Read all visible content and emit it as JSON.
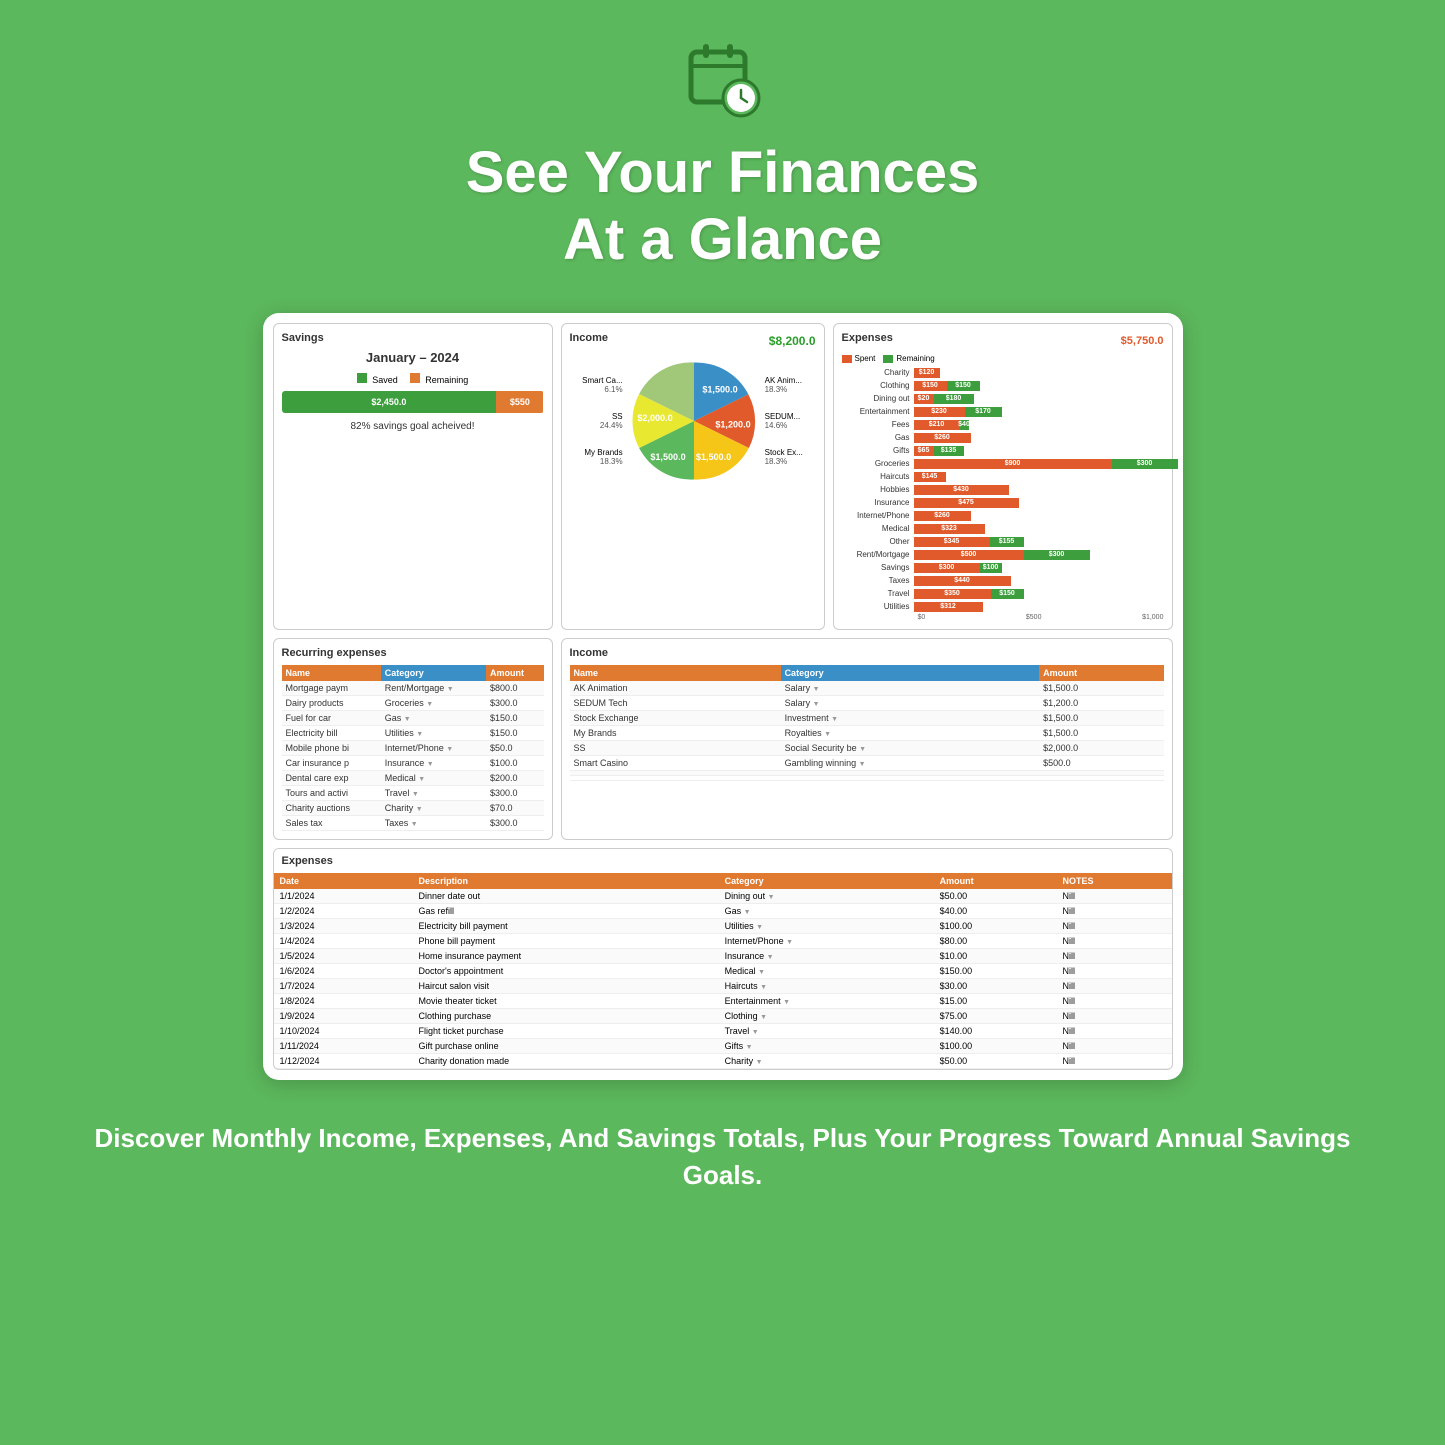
{
  "header": {
    "title_line1": "See Your Finances",
    "title_line2": "At a Glance",
    "icon_label": "calendar-clock-icon"
  },
  "savings": {
    "title": "Savings",
    "month": "January – 2024",
    "legend_saved": "Saved",
    "legend_remaining": "Remaining",
    "saved_amount": "$2,450.0",
    "remaining_amount": "$550",
    "goal_text": "82% savings goal acheived!",
    "saved_pct": 82,
    "remaining_pct": 18
  },
  "income": {
    "title": "Income",
    "total": "$8,200.0",
    "segments": [
      {
        "label": "AK Anim...",
        "pct": 18.3,
        "value": 1500,
        "color": "#3a8fc7"
      },
      {
        "label": "SEDUM...",
        "pct": 14.6,
        "value": 1200,
        "color": "#e05a2b"
      },
      {
        "label": "Stock Ex...",
        "pct": 18.3,
        "value": 1500,
        "color": "#f5c518"
      },
      {
        "label": "My Brands",
        "pct": 18.3,
        "value": 1500,
        "color": "#5cb85c"
      },
      {
        "label": "SS",
        "pct": 24.4,
        "value": 2000,
        "color": "#e8e830"
      },
      {
        "label": "Smart Ca...",
        "pct": 6.1,
        "value": 500,
        "color": "#a0c878"
      }
    ]
  },
  "expenses_chart": {
    "title": "Expenses",
    "total": "$5,750.0",
    "legend_spent": "Spent",
    "legend_remaining": "Remaining",
    "max_val": 1000,
    "axis_labels": [
      "$0",
      "$500",
      "$1,000"
    ],
    "bars": [
      {
        "label": "Charity",
        "spent": 120,
        "remaining": 0
      },
      {
        "label": "Clothing",
        "spent": 150,
        "remaining": 150
      },
      {
        "label": "Dining out",
        "spent": 20,
        "remaining": 180
      },
      {
        "label": "Entertainment",
        "spent": 230,
        "remaining": 170
      },
      {
        "label": "Fees",
        "spent": 210,
        "remaining": 40
      },
      {
        "label": "Gas",
        "spent": 260,
        "remaining": 0
      },
      {
        "label": "Gifts",
        "spent": 65,
        "remaining": 135
      },
      {
        "label": "Groceries",
        "spent": 900,
        "remaining": 300
      },
      {
        "label": "Haircuts",
        "spent": 145,
        "remaining": 0
      },
      {
        "label": "Hobbies",
        "spent": 430,
        "remaining": 0
      },
      {
        "label": "Insurance",
        "spent": 475,
        "remaining": 0
      },
      {
        "label": "Internet/Phone",
        "spent": 260,
        "remaining": 0
      },
      {
        "label": "Medical",
        "spent": 323,
        "remaining": 0
      },
      {
        "label": "Other",
        "spent": 345,
        "remaining": 155
      },
      {
        "label": "Rent/Mortgage",
        "spent": 500,
        "remaining": 300
      },
      {
        "label": "Savings",
        "spent": 300,
        "remaining": 100
      },
      {
        "label": "Taxes",
        "spent": 440,
        "remaining": 0
      },
      {
        "label": "Travel",
        "spent": 350,
        "remaining": 150
      },
      {
        "label": "Utilities",
        "spent": 312,
        "remaining": 0
      }
    ]
  },
  "recurring": {
    "title": "Recurring expenses",
    "col_name": "Name",
    "col_category": "Category",
    "col_amount": "Amount",
    "rows": [
      {
        "name": "Mortgage paym",
        "category": "Rent/Mortgage",
        "amount": "$800.0"
      },
      {
        "name": "Dairy products",
        "category": "Groceries",
        "amount": "$300.0"
      },
      {
        "name": "Fuel for car",
        "category": "Gas",
        "amount": "$150.0"
      },
      {
        "name": "Electricity bill",
        "category": "Utilities",
        "amount": "$150.0"
      },
      {
        "name": "Mobile phone bi",
        "category": "Internet/Phone",
        "amount": "$50.0"
      },
      {
        "name": "Car insurance p",
        "category": "Insurance",
        "amount": "$100.0"
      },
      {
        "name": "Dental care exp",
        "category": "Medical",
        "amount": "$200.0"
      },
      {
        "name": "Tours and activi",
        "category": "Travel",
        "amount": "$300.0"
      },
      {
        "name": "Charity auctions",
        "category": "Charity",
        "amount": "$70.0"
      },
      {
        "name": "Sales tax",
        "category": "Taxes",
        "amount": "$300.0"
      }
    ]
  },
  "income_table": {
    "title": "Income",
    "col_name": "Name",
    "col_category": "Category",
    "col_amount": "Amount",
    "rows": [
      {
        "name": "AK Animation",
        "category": "Salary",
        "amount": "$1,500.0"
      },
      {
        "name": "SEDUM Tech",
        "category": "Salary",
        "amount": "$1,200.0"
      },
      {
        "name": "Stock Exchange",
        "category": "Investment",
        "amount": "$1,500.0"
      },
      {
        "name": "My Brands",
        "category": "Royalties",
        "amount": "$1,500.0"
      },
      {
        "name": "SS",
        "category": "Social Security be",
        "amount": "$2,000.0"
      },
      {
        "name": "Smart Casino",
        "category": "Gambling winning",
        "amount": "$500.0"
      },
      {
        "name": "",
        "category": "",
        "amount": ""
      },
      {
        "name": "",
        "category": "",
        "amount": ""
      }
    ]
  },
  "expenses_table": {
    "title": "Expenses",
    "col_date": "Date",
    "col_description": "Description",
    "col_category": "Category",
    "col_amount": "Amount",
    "col_notes": "NOTES",
    "rows": [
      {
        "date": "1/1/2024",
        "description": "Dinner date out",
        "category": "Dining out",
        "amount": "$50.00",
        "notes": "Nill"
      },
      {
        "date": "1/2/2024",
        "description": "Gas refill",
        "category": "Gas",
        "amount": "$40.00",
        "notes": "Nill"
      },
      {
        "date": "1/3/2024",
        "description": "Electricity bill payment",
        "category": "Utilities",
        "amount": "$100.00",
        "notes": "Nill"
      },
      {
        "date": "1/4/2024",
        "description": "Phone bill payment",
        "category": "Internet/Phone",
        "amount": "$80.00",
        "notes": "Nill"
      },
      {
        "date": "1/5/2024",
        "description": "Home insurance payment",
        "category": "Insurance",
        "amount": "$10.00",
        "notes": "Nill"
      },
      {
        "date": "1/6/2024",
        "description": "Doctor's appointment",
        "category": "Medical",
        "amount": "$150.00",
        "notes": "Nill"
      },
      {
        "date": "1/7/2024",
        "description": "Haircut salon visit",
        "category": "Haircuts",
        "amount": "$30.00",
        "notes": "Nill"
      },
      {
        "date": "1/8/2024",
        "description": "Movie theater ticket",
        "category": "Entertainment",
        "amount": "$15.00",
        "notes": "Nill"
      },
      {
        "date": "1/9/2024",
        "description": "Clothing purchase",
        "category": "Clothing",
        "amount": "$75.00",
        "notes": "Nill"
      },
      {
        "date": "1/10/2024",
        "description": "Flight ticket purchase",
        "category": "Travel",
        "amount": "$140.00",
        "notes": "Nill"
      },
      {
        "date": "1/11/2024",
        "description": "Gift purchase online",
        "category": "Gifts",
        "amount": "$100.00",
        "notes": "Nill"
      },
      {
        "date": "1/12/2024",
        "description": "Charity donation made",
        "category": "Charity",
        "amount": "$50.00",
        "notes": "Nill"
      }
    ]
  },
  "footer": {
    "text": "Discover Monthly Income, Expenses, And Savings Totals, Plus Your Progress Toward Annual Savings Goals."
  }
}
